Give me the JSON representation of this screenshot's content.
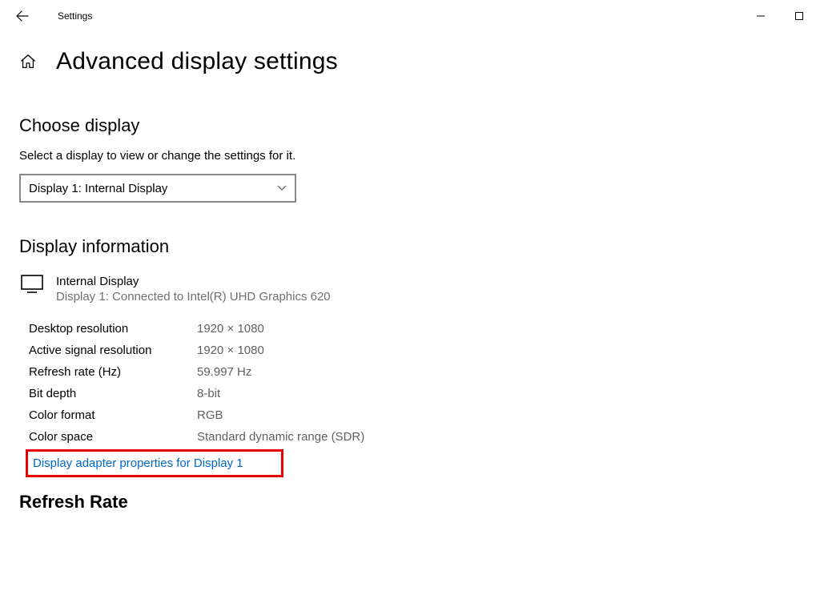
{
  "titlebar": {
    "title": "Settings"
  },
  "page": {
    "title": "Advanced display settings"
  },
  "chooseDisplay": {
    "heading": "Choose display",
    "helper": "Select a display to view or change the settings for it.",
    "selected": "Display 1: Internal Display"
  },
  "displayInfo": {
    "heading": "Display information",
    "name": "Internal Display",
    "sub": "Display 1: Connected to Intel(R) UHD Graphics 620",
    "rows": [
      {
        "label": "Desktop resolution",
        "value": "1920 × 1080"
      },
      {
        "label": "Active signal resolution",
        "value": "1920 × 1080"
      },
      {
        "label": "Refresh rate (Hz)",
        "value": "59.997 Hz"
      },
      {
        "label": "Bit depth",
        "value": "8-bit"
      },
      {
        "label": "Color format",
        "value": "RGB"
      },
      {
        "label": "Color space",
        "value": "Standard dynamic range (SDR)"
      }
    ],
    "link": "Display adapter properties for Display 1"
  },
  "refreshRate": {
    "heading": "Refresh Rate"
  }
}
